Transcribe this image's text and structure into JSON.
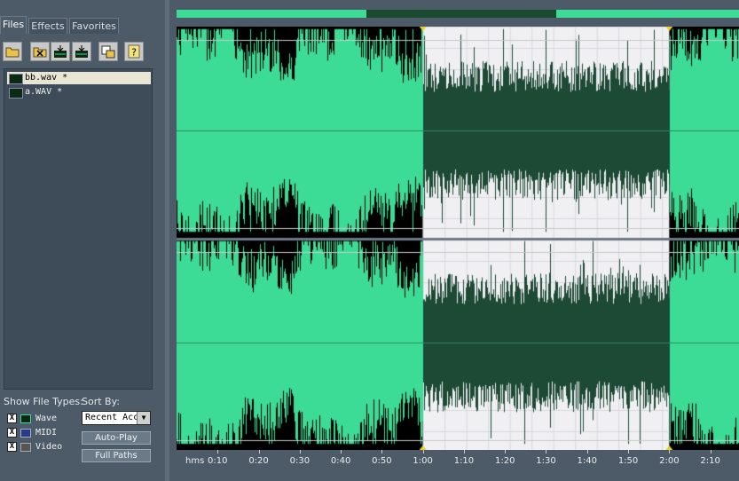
{
  "left_panel": {
    "tabs": [
      {
        "label": "Files",
        "active": true
      },
      {
        "label": "Effects",
        "active": false
      },
      {
        "label": "Favorites",
        "active": false
      }
    ],
    "toolbar_icons": [
      "open-file-icon",
      "close-file-icon",
      "insert-into-multitrack-icon",
      "insert-audio-icon",
      "edit-file-icon",
      "help-icon"
    ],
    "files": [
      {
        "name": "bb.wav *",
        "selected": true
      },
      {
        "name": "a.WAV *",
        "selected": false
      }
    ],
    "show_file_types_label": "Show File Types:",
    "sort_by_label": "Sort By:",
    "file_types": [
      {
        "label": "Wave",
        "checked": true,
        "check_mark": "X"
      },
      {
        "label": "MIDI",
        "checked": true,
        "check_mark": "X"
      },
      {
        "label": "Video",
        "checked": true,
        "check_mark": "X"
      }
    ],
    "sort_by_value": "Recent Acc",
    "dropdown_arrow": "▼",
    "autoplay_label": "Auto-Play",
    "fullpaths_label": "Full Paths"
  },
  "waveform": {
    "waveform_color": "#3cdc96",
    "selection_waveform_color": "#1d4a35",
    "selection_background": "#f0f0f3",
    "background": "#000000",
    "selection_start": "1:00",
    "selection_end": "2:00",
    "view_range_seconds": [
      0,
      137
    ],
    "overview_fraction": [
      0.338,
      0.675
    ]
  },
  "time_ruler": {
    "unit_label": "hms",
    "ticks": [
      "0:10",
      "0:20",
      "0:30",
      "0:40",
      "0:50",
      "1:00",
      "1:10",
      "1:20",
      "1:30",
      "1:40",
      "1:50",
      "2:00",
      "2:10"
    ],
    "tick_seconds": [
      10,
      20,
      30,
      40,
      50,
      60,
      70,
      80,
      90,
      100,
      110,
      120,
      130
    ]
  }
}
